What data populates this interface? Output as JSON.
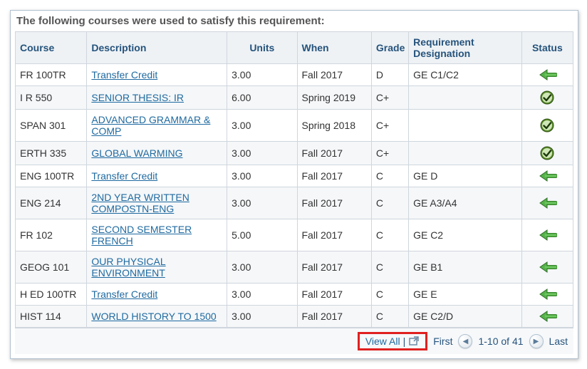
{
  "title": "The following courses were used to satisfy this requirement:",
  "headers": {
    "course": "Course",
    "description": "Description",
    "units": "Units",
    "when": "When",
    "grade": "Grade",
    "requirement": "Requirement Designation",
    "status": "Status"
  },
  "rows": [
    {
      "course": "FR 100TR",
      "description": "Transfer Credit",
      "units": "3.00",
      "when": "Fall 2017",
      "grade": "D",
      "requirement": "GE C1/C2",
      "status": "arrow"
    },
    {
      "course": "I R 550",
      "description": "SENIOR THESIS: IR",
      "units": "6.00",
      "when": "Spring 2019",
      "grade": "C+",
      "requirement": "",
      "status": "check"
    },
    {
      "course": "SPAN 301",
      "description": "ADVANCED GRAMMAR & COMP",
      "units": "3.00",
      "when": "Spring 2018",
      "grade": "C+",
      "requirement": "",
      "status": "check"
    },
    {
      "course": "ERTH 335",
      "description": "GLOBAL WARMING",
      "units": "3.00",
      "when": "Fall 2017",
      "grade": "C+",
      "requirement": "",
      "status": "check"
    },
    {
      "course": "ENG 100TR",
      "description": "Transfer Credit",
      "units": "3.00",
      "when": "Fall 2017",
      "grade": "C",
      "requirement": "GE D",
      "status": "arrow"
    },
    {
      "course": "ENG 214",
      "description": "2ND YEAR WRITTEN COMPOSTN-ENG",
      "units": "3.00",
      "when": "Fall 2017",
      "grade": "C",
      "requirement": "GE A3/A4",
      "status": "arrow"
    },
    {
      "course": "FR 102",
      "description": "SECOND SEMESTER FRENCH",
      "units": "5.00",
      "when": "Fall 2017",
      "grade": "C",
      "requirement": "GE C2",
      "status": "arrow"
    },
    {
      "course": "GEOG 101",
      "description": "OUR PHYSICAL ENVIRONMENT",
      "units": "3.00",
      "when": "Fall 2017",
      "grade": "C",
      "requirement": "GE B1",
      "status": "arrow"
    },
    {
      "course": "H ED 100TR",
      "description": "Transfer Credit",
      "units": "3.00",
      "when": "Fall 2017",
      "grade": "C",
      "requirement": "GE E",
      "status": "arrow"
    },
    {
      "course": "HIST 114",
      "description": "WORLD HISTORY TO 1500",
      "units": "3.00",
      "when": "Fall 2017",
      "grade": "C",
      "requirement": "GE C2/D",
      "status": "arrow"
    }
  ],
  "footer": {
    "view_all": "View All",
    "first": "First",
    "last": "Last",
    "range": "1-10 of 41"
  },
  "icons": {
    "arrow": "transfer-arrow-icon",
    "check": "completed-check-icon",
    "popout": "popout-icon",
    "prev": "◀",
    "next": "▶"
  },
  "chart_data": {
    "type": "table",
    "title": "The following courses were used to satisfy this requirement:",
    "columns": [
      "Course",
      "Description",
      "Units",
      "When",
      "Grade",
      "Requirement Designation",
      "Status"
    ],
    "rows": [
      [
        "FR 100TR",
        "Transfer Credit",
        "3.00",
        "Fall 2017",
        "D",
        "GE C1/C2",
        "transfer"
      ],
      [
        "I R 550",
        "SENIOR THESIS: IR",
        "6.00",
        "Spring 2019",
        "C+",
        "",
        "completed"
      ],
      [
        "SPAN 301",
        "ADVANCED GRAMMAR & COMP",
        "3.00",
        "Spring 2018",
        "C+",
        "",
        "completed"
      ],
      [
        "ERTH 335",
        "GLOBAL WARMING",
        "3.00",
        "Fall 2017",
        "C+",
        "",
        "completed"
      ],
      [
        "ENG 100TR",
        "Transfer Credit",
        "3.00",
        "Fall 2017",
        "C",
        "GE D",
        "transfer"
      ],
      [
        "ENG 214",
        "2ND YEAR WRITTEN COMPOSTN-ENG",
        "3.00",
        "Fall 2017",
        "C",
        "GE A3/A4",
        "transfer"
      ],
      [
        "FR 102",
        "SECOND SEMESTER FRENCH",
        "5.00",
        "Fall 2017",
        "C",
        "GE C2",
        "transfer"
      ],
      [
        "GEOG 101",
        "OUR PHYSICAL ENVIRONMENT",
        "3.00",
        "Fall 2017",
        "C",
        "GE B1",
        "transfer"
      ],
      [
        "H ED 100TR",
        "Transfer Credit",
        "3.00",
        "Fall 2017",
        "C",
        "GE E",
        "transfer"
      ],
      [
        "HIST 114",
        "WORLD HISTORY TO 1500",
        "3.00",
        "Fall 2017",
        "C",
        "GE C2/D",
        "transfer"
      ]
    ],
    "pagination": {
      "range": "1-10 of 41"
    }
  }
}
